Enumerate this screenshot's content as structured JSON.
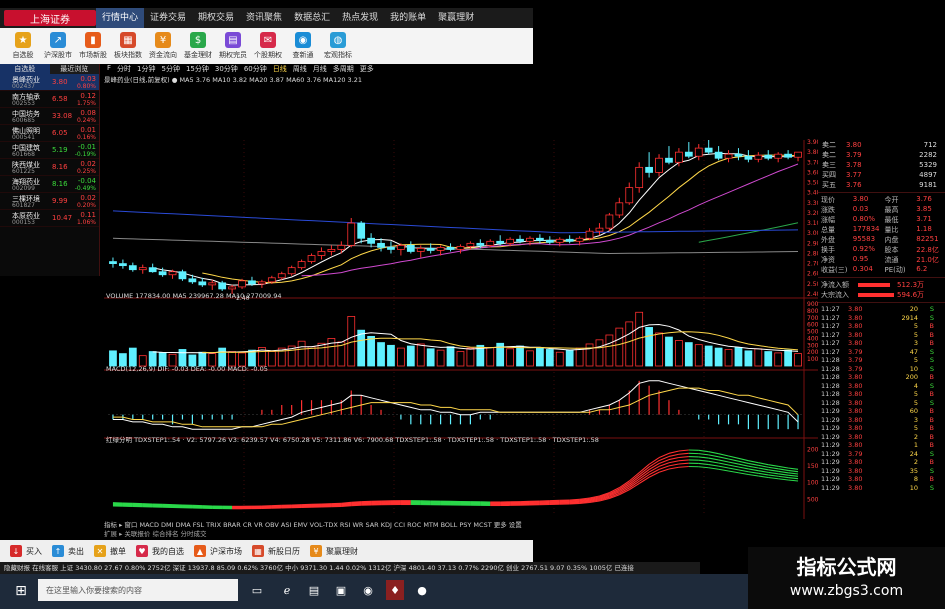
{
  "window": {
    "logo_text": "上海证券",
    "menu": [
      "行情中心",
      "证券交易",
      "期权交易",
      "资讯聚焦",
      "数据总汇",
      "热点发现",
      "我的账单",
      "聚赢理财"
    ],
    "active_menu": 0
  },
  "toolbar": [
    {
      "label": "自选股",
      "icon": "star-icon",
      "color": "#e6a21a"
    },
    {
      "label": "沪深股市",
      "icon": "chart-icon",
      "color": "#2a8cd6"
    },
    {
      "label": "市场新股",
      "icon": "bars-icon",
      "color": "#e65b1a"
    },
    {
      "label": "板块指数",
      "icon": "grid-icon",
      "color": "#d64a2a"
    },
    {
      "label": "资金流向",
      "icon": "coin-icon",
      "color": "#e68a1a"
    },
    {
      "label": "基金理财",
      "icon": "fund-icon",
      "color": "#2aa84a"
    },
    {
      "label": "期权完员",
      "icon": "doc-icon",
      "color": "#7a4ad6"
    },
    {
      "label": "个股期权",
      "icon": "mail-icon",
      "color": "#d62a4a"
    },
    {
      "label": "查新通",
      "icon": "eye-icon",
      "color": "#1a8cd6"
    },
    {
      "label": "宏观指标",
      "icon": "globe-icon",
      "color": "#2a9cd6"
    }
  ],
  "watchlist": {
    "headers": [
      "自选股",
      "最近浏览"
    ],
    "items": [
      {
        "name": "景峰药业",
        "code": "002437",
        "price": "3.80",
        "chg": "0.03",
        "pct": "0.80%",
        "dir": "up",
        "selected": true
      },
      {
        "name": "南方轴承",
        "code": "002553",
        "price": "6.58",
        "chg": "0.12",
        "pct": "1.75%",
        "dir": "up"
      },
      {
        "name": "中国坊务",
        "code": "600685",
        "price": "33.08",
        "chg": "0.08",
        "pct": "0.24%",
        "dir": "up"
      },
      {
        "name": "佛山照明",
        "code": "000541",
        "price": "6.05",
        "chg": "0.01",
        "pct": "0.16%",
        "dir": "up"
      },
      {
        "name": "中国建筑",
        "code": "601668",
        "price": "5.19",
        "chg": "-0.01",
        "pct": "-0.19%",
        "dir": "down"
      },
      {
        "name": "陕西煤业",
        "code": "601225",
        "price": "8.16",
        "chg": "0.02",
        "pct": "0.25%",
        "dir": "up"
      },
      {
        "name": "海翔药业",
        "code": "002099",
        "price": "8.16",
        "chg": "-0.04",
        "pct": "-0.49%",
        "dir": "down"
      },
      {
        "name": "三棵环境",
        "code": "601827",
        "price": "9.99",
        "chg": "0.02",
        "pct": "0.20%",
        "dir": "up"
      },
      {
        "name": "本原药业",
        "code": "000153",
        "price": "10.47",
        "chg": "0.11",
        "pct": "1.06%",
        "dir": "up"
      }
    ]
  },
  "period_bar": [
    "F",
    "分时",
    "1分钟",
    "5分钟",
    "15分钟",
    "30分钟",
    "60分钟",
    "日线",
    "周线",
    "月线",
    "多周期",
    "更多"
  ],
  "ma_line": "景峰药业(日线,前复权) ● MA5 3.76 MA10 3.82 MA20 3.87 MA60 3.76 MA120 3.21",
  "indicator_titles": {
    "volume": "VOLUME 177834.00 MA5 239967.28 MA10 277009.94",
    "macd": "MACD(12,26,9) DIF: -0.03 DEA: -0.00 MACD: -0.05",
    "custom": "红绿分明 TDXSTEP1:.54 · V2: 5797.26 V3: 6239.57 V4: 6750.28 V5: 7311.86 V6: 7900.68 TDXSTEP1:.58 · TDXSTEP1:.58 · TDXSTEP1:.58 · TDXSTEP1:.58"
  },
  "price_axis": [
    "3.90",
    "3.80",
    "3.70",
    "3.60",
    "3.50",
    "3.40",
    "3.30",
    "3.20",
    "3.10",
    "3.00",
    "2.90",
    "2.80",
    "2.70",
    "2.60",
    "2.50",
    "2.40"
  ],
  "volume_axis": [
    "9000",
    "8000",
    "7000",
    "6000",
    "5000",
    "4000",
    "3000",
    "2000",
    "1000"
  ],
  "custom_axis": [
    "20000",
    "15000",
    "10000",
    "5000"
  ],
  "low_label": "2.40",
  "orderbook": [
    {
      "label": "卖二",
      "price": "3.80",
      "vol": "712"
    },
    {
      "label": "卖二",
      "price": "3.79",
      "vol": "2282"
    },
    {
      "label": "卖三",
      "price": "3.78",
      "vol": "5329"
    },
    {
      "label": "买四",
      "price": "3.77",
      "vol": "4897"
    },
    {
      "label": "买五",
      "price": "3.76",
      "vol": "9181"
    }
  ],
  "info_rows": [
    [
      "现价",
      "3.80",
      "今开",
      "3.76"
    ],
    [
      "涨跌",
      "0.03",
      "最高",
      "3.85"
    ],
    [
      "涨幅",
      "0.80%",
      "最低",
      "3.71"
    ],
    [
      "总量",
      "177834",
      "量比",
      "1.18"
    ],
    [
      "外盘",
      "95583",
      "内盘",
      "82251"
    ],
    [
      "换手",
      "0.92%",
      "股本",
      "22.8亿"
    ],
    [
      "净资",
      "0.95",
      "流通",
      "21.0亿"
    ],
    [
      "收益(三)",
      "0.304",
      "PE(动)",
      "6.2"
    ]
  ],
  "flows": [
    {
      "label": "净流入额",
      "value": "512.3万",
      "pct": "8%"
    },
    {
      "label": "大宗流入",
      "value": "594.6万",
      "pct": "9%"
    }
  ],
  "ticks": [
    [
      "11:27",
      "3.80",
      "20",
      "S"
    ],
    [
      "11:27",
      "3.80",
      "2914",
      "S"
    ],
    [
      "11:27",
      "3.80",
      "5",
      "B"
    ],
    [
      "11:27",
      "3.80",
      "5",
      "B"
    ],
    [
      "11:27",
      "3.80",
      "3",
      "B"
    ],
    [
      "11:27",
      "3.79",
      "47",
      "S"
    ],
    [
      "11:28",
      "3.79",
      "5",
      "S"
    ],
    [
      "11:28",
      "3.79",
      "10",
      "S"
    ],
    [
      "11:28",
      "3.80",
      "200",
      "B"
    ],
    [
      "11:28",
      "3.80",
      "4",
      "S"
    ],
    [
      "11:28",
      "3.80",
      "5",
      "B"
    ],
    [
      "11:28",
      "3.80",
      "5",
      "S"
    ],
    [
      "11:29",
      "3.80",
      "60",
      "B"
    ],
    [
      "11:29",
      "3.80",
      "3",
      "B"
    ],
    [
      "11:29",
      "3.80",
      "5",
      "B"
    ],
    [
      "11:29",
      "3.80",
      "2",
      "B"
    ],
    [
      "11:29",
      "3.80",
      "1",
      "B"
    ],
    [
      "11:29",
      "3.79",
      "24",
      "S"
    ],
    [
      "11:29",
      "3.80",
      "2",
      "B"
    ],
    [
      "11:29",
      "3.80",
      "35",
      "S"
    ],
    [
      "11:29",
      "3.80",
      "8",
      "B"
    ],
    [
      "11:29",
      "3.80",
      "10",
      "S"
    ]
  ],
  "indicator_tabs": "指标 ▸ 窗口 MACD DMI DMA FSL TRIX BRAR CR VR OBV ASI EMV VOL-TDX RSI WR SAR KDJ CCI ROC MTM BOLL PSY MCST 更多 设置",
  "bottom_tabs": "扩展 ▸ 关联报价 综合排名 分时成交",
  "bottom_buttons": [
    {
      "label": "买入",
      "icon": "buy-icon",
      "color": "#d62a2a"
    },
    {
      "label": "卖出",
      "icon": "sell-icon",
      "color": "#2a8cd6"
    },
    {
      "label": "撤单",
      "icon": "cancel-icon",
      "color": "#e6a21a"
    },
    {
      "label": "我的自选",
      "icon": "favorite-icon",
      "color": "#d62a4a"
    },
    {
      "label": "沪深市场",
      "icon": "market-icon",
      "color": "#e65b1a"
    },
    {
      "label": "新股日历",
      "icon": "calendar-icon",
      "color": "#d64a2a"
    },
    {
      "label": "聚赢理财",
      "icon": "wealth-icon",
      "color": "#e68a1a"
    }
  ],
  "ticker": "隐藏财报  在线客服  上证 3430.80 27.67 0.80% 2752亿  深证 13937.8 85.09 0.62% 3760亿  中小 9371.30 1.44 0.02% 1312亿  沪深 4801.40 37.13 0.77% 2290亿  创业 2767.51 9.07 0.35% 1005亿  已连接",
  "taskbar": {
    "search_placeholder": "在这里输入你要搜索的内容"
  },
  "watermark": {
    "title": "指标公式网",
    "url": "www.zbgs3.com"
  },
  "chart_data": {
    "type": "candlestick",
    "title": "景峰药业(日线,前复权)",
    "ylim": [
      2.4,
      3.92
    ],
    "candles": [
      [
        2.72,
        2.76,
        2.66,
        2.7
      ],
      [
        2.7,
        2.74,
        2.65,
        2.68
      ],
      [
        2.68,
        2.71,
        2.62,
        2.64
      ],
      [
        2.64,
        2.69,
        2.6,
        2.66
      ],
      [
        2.66,
        2.7,
        2.61,
        2.62
      ],
      [
        2.62,
        2.66,
        2.57,
        2.59
      ],
      [
        2.59,
        2.64,
        2.55,
        2.62
      ],
      [
        2.62,
        2.64,
        2.53,
        2.55
      ],
      [
        2.55,
        2.59,
        2.5,
        2.52
      ],
      [
        2.52,
        2.56,
        2.47,
        2.49
      ],
      [
        2.49,
        2.54,
        2.44,
        2.51
      ],
      [
        2.51,
        2.53,
        2.43,
        2.45
      ],
      [
        2.45,
        2.49,
        2.4,
        2.47
      ],
      [
        2.47,
        2.55,
        2.45,
        2.53
      ],
      [
        2.53,
        2.57,
        2.48,
        2.5
      ],
      [
        2.5,
        2.54,
        2.46,
        2.52
      ],
      [
        2.52,
        2.58,
        2.5,
        2.56
      ],
      [
        2.56,
        2.62,
        2.54,
        2.6
      ],
      [
        2.6,
        2.68,
        2.58,
        2.66
      ],
      [
        2.66,
        2.74,
        2.64,
        2.72
      ],
      [
        2.72,
        2.8,
        2.7,
        2.78
      ],
      [
        2.78,
        2.86,
        2.74,
        2.82
      ],
      [
        2.82,
        2.88,
        2.78,
        2.84
      ],
      [
        2.84,
        2.92,
        2.8,
        2.88
      ],
      [
        2.88,
        3.15,
        2.86,
        3.1
      ],
      [
        3.1,
        3.12,
        2.9,
        2.95
      ],
      [
        2.95,
        3.0,
        2.86,
        2.9
      ],
      [
        2.9,
        2.95,
        2.82,
        2.86
      ],
      [
        2.86,
        2.92,
        2.8,
        2.84
      ],
      [
        2.84,
        2.9,
        2.78,
        2.88
      ],
      [
        2.88,
        2.92,
        2.8,
        2.82
      ],
      [
        2.82,
        2.88,
        2.76,
        2.85
      ],
      [
        2.85,
        2.9,
        2.8,
        2.83
      ],
      [
        2.83,
        2.88,
        2.78,
        2.86
      ],
      [
        2.86,
        2.9,
        2.82,
        2.84
      ],
      [
        2.84,
        2.89,
        2.8,
        2.87
      ],
      [
        2.87,
        2.92,
        2.84,
        2.9
      ],
      [
        2.9,
        2.94,
        2.85,
        2.88
      ],
      [
        2.88,
        2.94,
        2.86,
        2.92
      ],
      [
        2.92,
        2.98,
        2.88,
        2.9
      ],
      [
        2.9,
        2.96,
        2.87,
        2.94
      ],
      [
        2.94,
        2.98,
        2.9,
        2.92
      ],
      [
        2.92,
        2.97,
        2.88,
        2.95
      ],
      [
        2.95,
        2.99,
        2.9,
        2.93
      ],
      [
        2.93,
        2.97,
        2.89,
        2.91
      ],
      [
        2.91,
        2.96,
        2.87,
        2.94
      ],
      [
        2.94,
        2.98,
        2.9,
        2.92
      ],
      [
        2.92,
        2.97,
        2.88,
        2.95
      ],
      [
        2.95,
        3.05,
        2.93,
        3.02
      ],
      [
        3.02,
        3.1,
        2.98,
        3.05
      ],
      [
        3.05,
        3.2,
        3.02,
        3.18
      ],
      [
        3.18,
        3.35,
        3.15,
        3.3
      ],
      [
        3.3,
        3.5,
        3.28,
        3.45
      ],
      [
        3.45,
        3.7,
        3.4,
        3.65
      ],
      [
        3.65,
        3.8,
        3.55,
        3.6
      ],
      [
        3.6,
        3.78,
        3.56,
        3.74
      ],
      [
        3.74,
        3.86,
        3.68,
        3.7
      ],
      [
        3.7,
        3.84,
        3.66,
        3.8
      ],
      [
        3.8,
        3.9,
        3.74,
        3.76
      ],
      [
        3.76,
        3.88,
        3.72,
        3.84
      ],
      [
        3.84,
        3.92,
        3.78,
        3.8
      ],
      [
        3.8,
        3.86,
        3.72,
        3.74
      ],
      [
        3.74,
        3.82,
        3.7,
        3.78
      ],
      [
        3.78,
        3.84,
        3.72,
        3.76
      ],
      [
        3.76,
        3.82,
        3.7,
        3.73
      ],
      [
        3.73,
        3.8,
        3.7,
        3.77
      ],
      [
        3.77,
        3.82,
        3.72,
        3.74
      ],
      [
        3.74,
        3.8,
        3.7,
        3.78
      ],
      [
        3.78,
        3.82,
        3.73,
        3.75
      ],
      [
        3.75,
        3.8,
        3.71,
        3.8
      ]
    ],
    "volume": [
      2200,
      1800,
      2600,
      1500,
      2100,
      1900,
      1700,
      2400,
      1600,
      2000,
      1800,
      2600,
      2100,
      1900,
      2300,
      2700,
      2100,
      2600,
      2900,
      3600,
      2800,
      3300,
      4000,
      3500,
      7200,
      5200,
      4300,
      3400,
      3000,
      2600,
      2900,
      3200,
      2500,
      2300,
      2800,
      2100,
      2600,
      3000,
      2700,
      3300,
      2500,
      2900,
      2200,
      2700,
      2400,
      2000,
      2300,
      2600,
      3200,
      3800,
      4500,
      5500,
      6400,
      7800,
      5600,
      4800,
      4200,
      3700,
      3400,
      3100,
      2900,
      2600,
      2400,
      2700,
      2200,
      2500,
      2100,
      1900,
      2300,
      1800
    ],
    "macd_dif": [
      -0.02,
      -0.02,
      -0.03,
      -0.03,
      -0.04,
      -0.04,
      -0.05,
      -0.05,
      -0.06,
      -0.06,
      -0.06,
      -0.06,
      -0.06,
      -0.05,
      -0.05,
      -0.04,
      -0.03,
      -0.02,
      -0.01,
      0.01,
      0.02,
      0.03,
      0.04,
      0.05,
      0.08,
      0.08,
      0.07,
      0.06,
      0.05,
      0.04,
      0.03,
      0.02,
      0.02,
      0.01,
      0.01,
      0.0,
      0.0,
      0.01,
      0.01,
      0.01,
      0.01,
      0.01,
      0.01,
      0.01,
      0.01,
      0.01,
      0.01,
      0.01,
      0.02,
      0.03,
      0.04,
      0.06,
      0.09,
      0.13,
      0.14,
      0.14,
      0.13,
      0.12,
      0.11,
      0.1,
      0.09,
      0.08,
      0.07,
      0.06,
      0.05,
      0.04,
      0.03,
      0.02,
      0.01,
      -0.03
    ],
    "macd_dea": [
      -0.01,
      -0.01,
      -0.02,
      -0.02,
      -0.03,
      -0.03,
      -0.03,
      -0.04,
      -0.04,
      -0.05,
      -0.05,
      -0.05,
      -0.05,
      -0.05,
      -0.05,
      -0.05,
      -0.04,
      -0.04,
      -0.03,
      -0.02,
      -0.01,
      0.0,
      0.01,
      0.02,
      0.03,
      0.04,
      0.05,
      0.05,
      0.05,
      0.05,
      0.05,
      0.04,
      0.04,
      0.03,
      0.03,
      0.02,
      0.02,
      0.02,
      0.02,
      0.01,
      0.01,
      0.01,
      0.01,
      0.01,
      0.01,
      0.01,
      0.01,
      0.01,
      0.01,
      0.02,
      0.02,
      0.03,
      0.04,
      0.06,
      0.08,
      0.09,
      0.1,
      0.11,
      0.11,
      0.11,
      0.1,
      0.1,
      0.09,
      0.08,
      0.08,
      0.07,
      0.06,
      0.05,
      0.04,
      0.0
    ],
    "custom_line": [
      4000,
      3900,
      3800,
      3700,
      3600,
      3500,
      3400,
      3300,
      3200,
      3100,
      3000,
      2950,
      2900,
      2900,
      2950,
      3000,
      3100,
      3200,
      3300,
      3400,
      3500,
      3600,
      3700,
      3800,
      4100,
      4300,
      4400,
      4500,
      4550,
      4600,
      4600,
      4550,
      4500,
      4450,
      4400,
      4350,
      4300,
      4250,
      4200,
      4200,
      4250,
      4300,
      4400,
      4500,
      4600,
      4700,
      4800,
      5000,
      5400,
      6000,
      7000,
      8500,
      10500,
      13000,
      15500,
      17500,
      18800,
      19500,
      19800,
      19700,
      19300,
      18700,
      18000,
      17300,
      16600,
      16000,
      15400,
      14900,
      14400,
      14000
    ]
  }
}
